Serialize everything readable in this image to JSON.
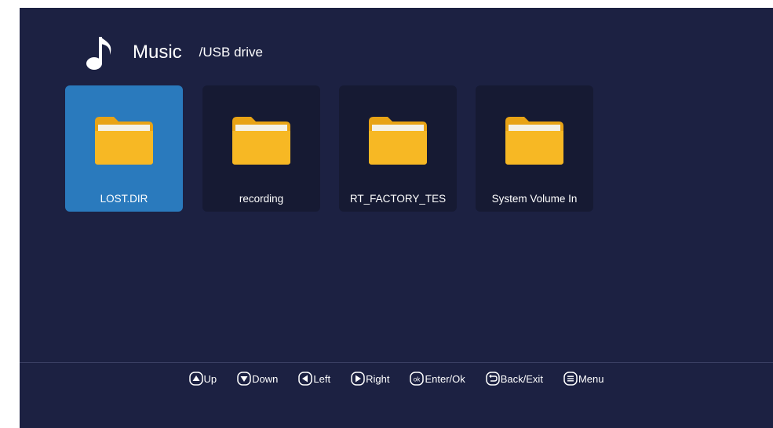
{
  "header": {
    "title": "Music",
    "path": "/USB drive",
    "icon": "music-note-icon"
  },
  "folders": [
    {
      "label": "LOST.DIR",
      "selected": true
    },
    {
      "label": "recording",
      "selected": false
    },
    {
      "label": "RT_FACTORY_TES",
      "selected": false
    },
    {
      "label": "System Volume In",
      "selected": false
    }
  ],
  "hints": {
    "up": "Up",
    "down": "Down",
    "left": "Left",
    "right": "Right",
    "enter": "Enter/Ok",
    "back": "Back/Exit",
    "menu": "Menu",
    "ok_glyph": "ok"
  },
  "colors": {
    "background": "#1c2142",
    "tile": "#161a33",
    "selected": "#2a7abd",
    "folder": "#f2b21e"
  }
}
